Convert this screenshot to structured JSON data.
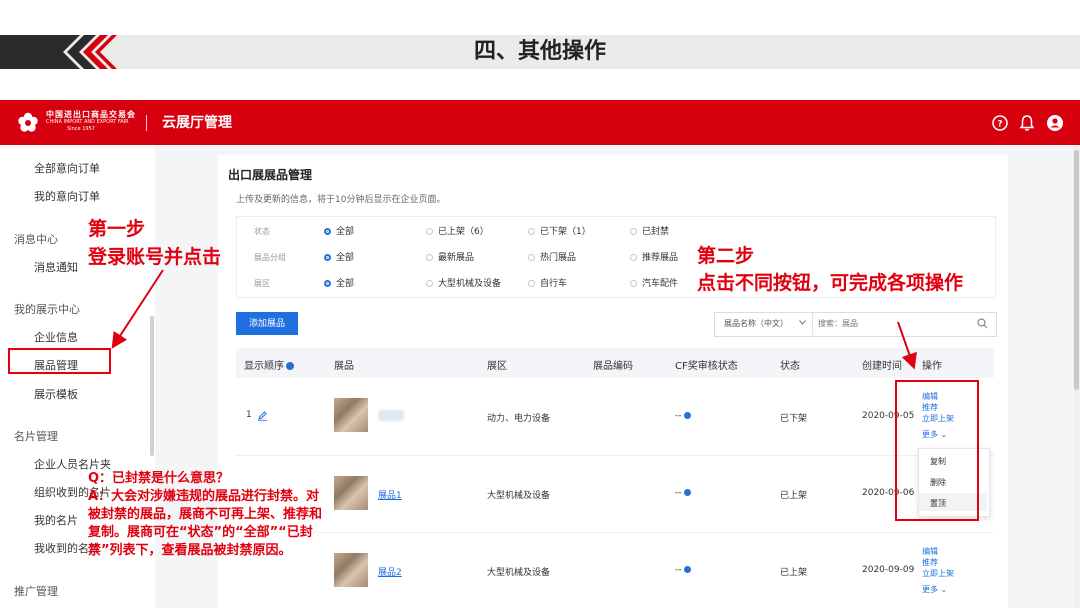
{
  "slide": {
    "title": "四、其他操作"
  },
  "header": {
    "logo_line1": "中国进出口商品交易会",
    "logo_line2": "CHINA IMPORT AND EXPORT FAIR",
    "logo_line3": "Since 1957",
    "app_title": "云展厅管理",
    "icons": [
      "help-icon",
      "bell-icon",
      "user-icon"
    ],
    "brand_color": "#d7000f"
  },
  "sidebar": {
    "items": [
      {
        "label": "全部意向订单",
        "type": "item"
      },
      {
        "label": "我的意向订单",
        "type": "item"
      },
      {
        "label": "消息中心",
        "type": "group"
      },
      {
        "label": "消息通知",
        "type": "item"
      },
      {
        "label": "我的展示中心",
        "type": "group"
      },
      {
        "label": "企业信息",
        "type": "item"
      },
      {
        "label": "展品管理",
        "type": "item",
        "active": true
      },
      {
        "label": "展示模板",
        "type": "item"
      },
      {
        "label": "名片管理",
        "type": "group"
      },
      {
        "label": "企业人员名片夹",
        "type": "item"
      },
      {
        "label": "组织收到的名片",
        "type": "item"
      },
      {
        "label": "我的名片",
        "type": "item"
      },
      {
        "label": "我收到的名片",
        "type": "item"
      },
      {
        "label": "推广管理",
        "type": "group"
      }
    ]
  },
  "main": {
    "title": "出口展展品管理",
    "subtitle": "上传及更新的信息，将于10分钟后显示在企业页面。",
    "filters": [
      {
        "label": "状态",
        "options": [
          "全部",
          "已上架（6）",
          "已下架（1）",
          "已封禁"
        ],
        "selected": 0
      },
      {
        "label": "展品分组",
        "options": [
          "全部",
          "最新展品",
          "热门展品",
          "推荐展品"
        ],
        "selected": 0
      },
      {
        "label": "展区",
        "options": [
          "全部",
          "大型机械及设备",
          "自行车",
          "汽车配件"
        ],
        "selected": 0
      }
    ],
    "add_button": "添加展品",
    "search": {
      "select": "展品名称（中文）",
      "placeholder": "搜索：展品"
    },
    "columns": [
      "显示顺序",
      "展品",
      "展区",
      "展品编码",
      "CF奖审核状态",
      "状态",
      "创建时间",
      "操作"
    ],
    "rows": [
      {
        "order": "1",
        "name": "",
        "zone": "动力、电力设备",
        "code": "",
        "cf": "--",
        "status": "已下架",
        "created": "2020-09-05"
      },
      {
        "order": "",
        "name": "展品1",
        "zone": "大型机械及设备",
        "code": "",
        "cf": "--",
        "status": "已上架",
        "created": "2020-09-06"
      },
      {
        "order": "",
        "name": "展品2",
        "zone": "大型机械及设备",
        "code": "",
        "cf": "--",
        "status": "已上架",
        "created": "2020-09-09"
      }
    ],
    "row_actions": [
      "编辑",
      "推荐",
      "立即上架",
      "更多"
    ],
    "dropdown": [
      "复制",
      "删除",
      "置顶"
    ]
  },
  "annotations": {
    "step1_title": "第一步",
    "step1_desc": "登录账号并点击",
    "step2_title": "第二步",
    "step2_desc": "点击不同按钮，可完成各项操作",
    "qa_q": "Q：已封禁是什么意思？",
    "qa_a": "A：大会对涉嫌违规的展品进行封禁。对被封禁的展品，展商不可再上架、推荐和复制。展商可在“状态”的“全部”“已封禁”列表下，查看展品被封禁原因。",
    "color": "#e0000f"
  }
}
